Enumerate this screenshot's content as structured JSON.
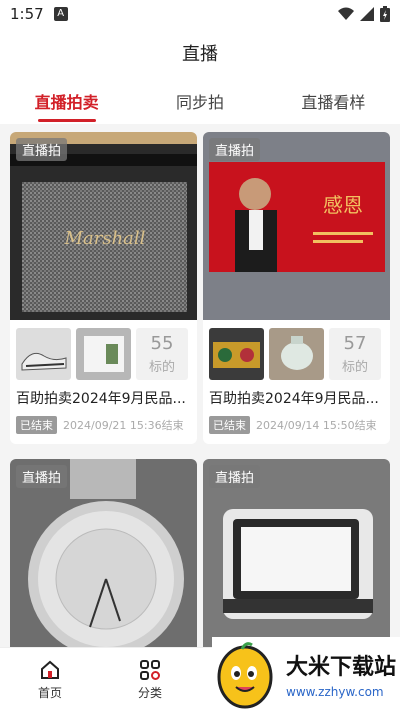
{
  "status_bar": {
    "time": "1:57",
    "notif_letter": "A"
  },
  "header": {
    "title": "直播"
  },
  "tabs": [
    {
      "label": "直播拍卖",
      "active": true
    },
    {
      "label": "同步拍",
      "active": false
    },
    {
      "label": "直播看样",
      "active": false
    }
  ],
  "cards": [
    {
      "tag": "直播拍",
      "title": "百助拍卖2024年9月民品...",
      "count": "55",
      "count_unit": "标的",
      "status": "已结束",
      "end_time": "2024/09/21 15:36结束"
    },
    {
      "tag": "直播拍",
      "title": "百助拍卖2024年9月民品...",
      "count": "57",
      "count_unit": "标的",
      "status": "已结束",
      "end_time": "2024/09/14 15:50结束"
    },
    {
      "tag": "直播拍"
    },
    {
      "tag": "直播拍"
    }
  ],
  "bottom_nav": [
    {
      "label": "首页",
      "icon": "home-icon"
    },
    {
      "label": "分类",
      "icon": "category-grid-icon"
    }
  ],
  "watermark": {
    "title": "大米下载站",
    "url": "www.zzhyw.com"
  },
  "colors": {
    "accent": "#d22028",
    "ended_badge": "#9a9a9a",
    "background": "#f4f4f4"
  }
}
